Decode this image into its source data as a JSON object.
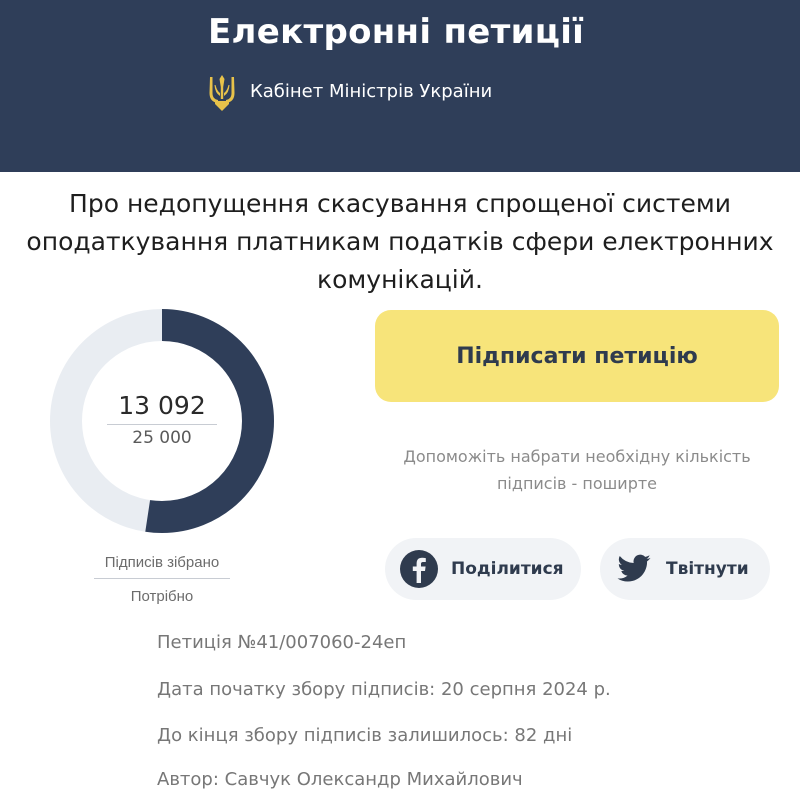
{
  "header": {
    "title": "Електронні петиції",
    "organization": "Кабінет Міністрів України",
    "background_color": "#2f3e59"
  },
  "petition": {
    "title_line1": "Про недопущення скасування спрощеної системи",
    "title_line2": "оподаткування платникам податків сфери електронних",
    "title_line3": "комунікацій."
  },
  "progress": {
    "signatures_collected": "13 092",
    "signatures_required": "25 000",
    "collected_value": 13092,
    "required_value": 25000,
    "collected_label": "Підписів зібрано",
    "required_label": "Потрібно",
    "fill_color": "#2f3e59",
    "track_color": "#e9edf2"
  },
  "actions": {
    "sign_label": "Підписати петицію",
    "sign_color": "#f7e47a",
    "help_line1": "Допоможіть набрати необхідну кількість",
    "help_line2": "підписів - поширте",
    "share_facebook_label": "Поділитися",
    "share_twitter_label": "Твітнути",
    "facebook_icon": "facebook-icon",
    "twitter_icon": "twitter-icon"
  },
  "details": {
    "number": "Петиція №41/007060-24еп",
    "start_date": "Дата початку збору підписів: 20 серпня 2024 р.",
    "days_left": "До кінця збору підписів залишилось: 82 дні",
    "author": "Автор: Савчук Олександр Михайлович"
  }
}
